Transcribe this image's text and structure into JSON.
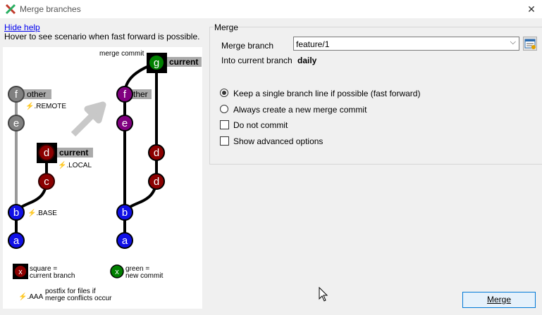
{
  "window": {
    "title": "Merge branches",
    "close_glyph": "✕"
  },
  "help": {
    "hide_help_link": "Hide help",
    "hover_hint": "Hover to see scenario when fast forward is possible."
  },
  "diagram": {
    "before": {
      "commits": [
        "f",
        "e",
        "d",
        "c",
        "b",
        "a"
      ],
      "labels": {
        "other": "other",
        "remote": ".REMOTE",
        "current": "current",
        "local": ".LOCAL",
        "base": ".BASE"
      }
    },
    "after": {
      "merge_commit_label": "merge commit",
      "commits": [
        "g",
        "f",
        "e",
        "d",
        "d",
        "b",
        "a"
      ],
      "labels": {
        "current": "current",
        "other_partial": "ther"
      }
    },
    "legend": {
      "square_marker": "x",
      "square_text_1": "square =",
      "square_text_2": "current branch",
      "green_marker": "x",
      "green_text_1": "green =",
      "green_text_2": "new commit",
      "postfix_marker": ".AAA",
      "postfix_text_1": "postfix for files if",
      "postfix_text_2": "merge conflicts occur"
    },
    "colors": {
      "blue": "#1010e6",
      "purple": "#800080",
      "darkred": "#8b0000",
      "gray": "#808080",
      "green": "#008000"
    }
  },
  "merge_group": {
    "title": "Merge",
    "merge_branch_label": "Merge branch",
    "merge_branch_value": "feature/1",
    "into_label": "Into current branch",
    "current_branch_value": "daily"
  },
  "options": {
    "fast_forward": {
      "label": "Keep a single branch line if possible (fast forward)",
      "checked": true
    },
    "always_merge_commit": {
      "label": "Always create a new merge commit",
      "checked": false
    },
    "do_not_commit": {
      "label": "Do not commit",
      "checked": false
    },
    "show_advanced": {
      "label": "Show advanced options",
      "checked": false
    }
  },
  "buttons": {
    "merge_label": "Merge"
  }
}
